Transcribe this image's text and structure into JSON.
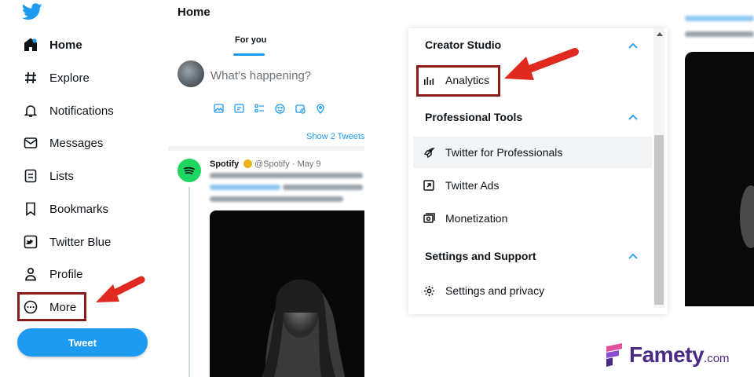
{
  "sidebar": {
    "items": [
      {
        "label": "Home",
        "icon": "home-icon"
      },
      {
        "label": "Explore",
        "icon": "hashtag-icon"
      },
      {
        "label": "Notifications",
        "icon": "bell-icon"
      },
      {
        "label": "Messages",
        "icon": "envelope-icon"
      },
      {
        "label": "Lists",
        "icon": "list-icon"
      },
      {
        "label": "Bookmarks",
        "icon": "bookmark-icon"
      },
      {
        "label": "Twitter Blue",
        "icon": "twitter-blue-icon"
      },
      {
        "label": "Profile",
        "icon": "person-icon"
      },
      {
        "label": "More",
        "icon": "more-circle-icon"
      }
    ],
    "tweet_button": "Tweet"
  },
  "main": {
    "title": "Home",
    "tabs": [
      {
        "label": "For you",
        "active": true
      }
    ],
    "compose_placeholder": "What’s happening?",
    "show_tweets": "Show 2 Tweets",
    "tweet": {
      "author": "Spotify",
      "meta": "@Spotify · May 9"
    }
  },
  "menu": {
    "sections": [
      {
        "title": "Creator Studio",
        "items": [
          {
            "label": "Analytics",
            "icon": "bar-chart-icon"
          }
        ]
      },
      {
        "title": "Professional Tools",
        "items": [
          {
            "label": "Twitter for Professionals",
            "icon": "rocket-icon"
          },
          {
            "label": "Twitter Ads",
            "icon": "external-arrow-icon"
          },
          {
            "label": "Monetization",
            "icon": "money-icon"
          }
        ]
      },
      {
        "title": "Settings and Support",
        "items": [
          {
            "label": "Settings and privacy",
            "icon": "gear-icon"
          }
        ]
      }
    ]
  },
  "watermark": {
    "brand": "Famety",
    "suffix": ".com"
  },
  "colors": {
    "accent": "#1d9bf0",
    "highlight_box": "#8b1a1a",
    "arrow": "#e02a1f",
    "spotify": "#1ed760",
    "watermark": "#4a2a82"
  }
}
